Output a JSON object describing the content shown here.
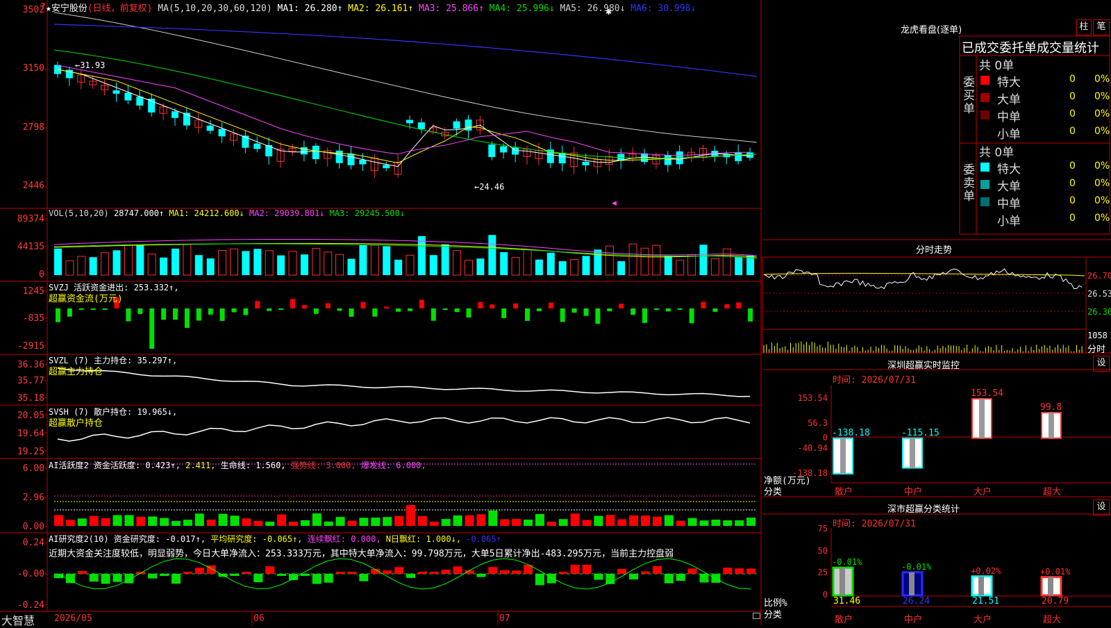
{
  "header": {
    "stock": "★安宁股份",
    "period": "(日线，前复权)",
    "ma_title": "MA(5,10,20,30,60,120)",
    "ma_values": [
      {
        "label": "MA1: 26.280↑",
        "color": "#ffffff"
      },
      {
        "label": "MA2: 26.161↑",
        "color": "#ffff00"
      },
      {
        "label": "MA3: 25.866↑",
        "color": "#ff44ff"
      },
      {
        "label": "MA4: 25.996↓",
        "color": "#00e000"
      },
      {
        "label": "MA5: 26.980↓",
        "color": "#cfcfcf"
      },
      {
        "label": "MA6: 30.998↓",
        "color": "#3333ff"
      }
    ]
  },
  "price_axis": [
    "3502",
    "3150",
    "2798",
    "2446"
  ],
  "price_annotations": {
    "high": "←31.93",
    "low": "←24.46"
  },
  "vol": {
    "title": "VOL(5,10,20)",
    "items": [
      {
        "label": "28747.000↑",
        "color": "#ffffff"
      },
      {
        "label": "MA1: 24212.600↓",
        "color": "#ffff00"
      },
      {
        "label": "MA2: 29039.801↓",
        "color": "#ff44ff"
      },
      {
        "label": "MA3: 29245.500↓",
        "color": "#00e000"
      }
    ],
    "axis": [
      "89374",
      "44135",
      "0"
    ]
  },
  "svzj": {
    "line1": "SVZJ  活跃资金进出: 253.332↑,",
    "line2": "超赢资金流(万元)",
    "axis": [
      "1245",
      "-835",
      "-2915"
    ]
  },
  "svzl": {
    "line1": "SVZL (7) 主力持仓: 35.297↑,",
    "line2": "超赢主力持仓",
    "axis": [
      "36.36",
      "35.77",
      "35.18"
    ]
  },
  "svsh": {
    "line1": "SVSH (7) 散户持仓: 19.965↓,",
    "line2": "超赢散户持仓",
    "axis": [
      "20.05",
      "19.64",
      "19.25"
    ]
  },
  "ai1": {
    "items": [
      {
        "label": "AI活跃度2 资金活跃度: 0.423↑,",
        "color": "#ffffff"
      },
      {
        "label": "2.411,",
        "color": "#ffff00"
      },
      {
        "label": "生命线: 1.560,",
        "color": "#ffffff"
      },
      {
        "label": "强势线: 3.000,",
        "color": "#ff3030"
      },
      {
        "label": "爆发线: 6.000,",
        "color": "#ff44ff"
      }
    ],
    "axis": [
      "6.00",
      "2.96",
      "0.00"
    ]
  },
  "ai2": {
    "items": [
      {
        "label": "AI研究度2(10) 资金研究度: -0.017↑,",
        "color": "#ffffff"
      },
      {
        "label": "平均研究度: -0.065↑,",
        "color": "#ffff00"
      },
      {
        "label": "连续飘红: 0.000,",
        "color": "#ff44ff"
      },
      {
        "label": "N日飘红: 1.000↓,",
        "color": "#ffff00"
      },
      {
        "label": "-0.065↑",
        "color": "#3333ff"
      }
    ],
    "comment": "近期大资金关注度较低，明显弱势，今日大单净流入：253.333万元，其中特大单净流入：99.798万元，大单5日累计净出-483.295万元，当前主力控盘弱",
    "axis": [
      "0.24",
      "-0.00",
      "-0.24"
    ]
  },
  "bottom": {
    "brand": "大智慧",
    "dates": [
      "2026/05",
      "06",
      "07"
    ]
  },
  "dragon": {
    "title": "龙虎看盘(逐单)",
    "tabs": [
      "柱",
      "笔"
    ],
    "subtitle": "已成交委托单成交量统计",
    "buy_label": "委买单",
    "sell_label": "委卖单",
    "buy_total": "共 0单",
    "sell_total": "共 0单",
    "buy_rows": [
      {
        "name": "特大",
        "n": "0",
        "p": "0%",
        "color": "#ff0000"
      },
      {
        "name": "大单",
        "n": "0",
        "p": "0%",
        "color": "#a00000"
      },
      {
        "name": "中单",
        "n": "0",
        "p": "0%",
        "color": "#700000"
      },
      {
        "name": "小单",
        "n": "0",
        "p": "0%",
        "color": ""
      }
    ],
    "sell_rows": [
      {
        "name": "特大",
        "n": "0",
        "p": "0%",
        "color": "#00ffff"
      },
      {
        "name": "大单",
        "n": "0",
        "p": "0%",
        "color": "#00a0a0"
      },
      {
        "name": "中单",
        "n": "0",
        "p": "0%",
        "color": "#007070"
      },
      {
        "name": "小单",
        "n": "0",
        "p": "0%",
        "color": ""
      }
    ]
  },
  "intraday": {
    "title": "分时走势",
    "axis": [
      "26.70",
      "26.53",
      "26.36"
    ],
    "vol_top": "1058",
    "vol_label": "分时"
  },
  "monitor": {
    "title": "深圳超赢实时监控",
    "setting": "设",
    "time": "时间: 2026/07/31",
    "axis": [
      "153.54",
      "56.3",
      "0",
      "-40.94",
      "-138.18"
    ],
    "ylabel": "净额(万元)",
    "xlabel": "分类",
    "bars": [
      {
        "cat": "散户",
        "value": -138.18,
        "label": "-138.18"
      },
      {
        "cat": "中户",
        "value": -115.15,
        "label": "-115.15"
      },
      {
        "cat": "大户",
        "value": 153.54,
        "label": "153.54"
      },
      {
        "cat": "超大",
        "value": 99.8,
        "label": "99.8"
      }
    ]
  },
  "classify": {
    "title": "深市超赢分类统计",
    "setting": "设",
    "time": "时间: 2026/07/31",
    "axis": [
      "75",
      "50",
      "25",
      "0"
    ],
    "ylabel": "比例%",
    "xlabel": "分类",
    "bars": [
      {
        "cat": "散户",
        "value": 31.46,
        "delta": "-0.01%",
        "label": "31.46"
      },
      {
        "cat": "中户",
        "value": 26.24,
        "delta": "-0.01%",
        "label": "26.24"
      },
      {
        "cat": "大户",
        "value": 21.51,
        "delta": "+0.02%",
        "label": "21.51"
      },
      {
        "cat": "超大",
        "value": 20.79,
        "delta": "+0.01%",
        "label": "20.79"
      }
    ]
  },
  "chart_data": [
    {
      "type": "bar",
      "title": "深圳超赢实时监控",
      "categories": [
        "散户",
        "中户",
        "大户",
        "超大"
      ],
      "values": [
        -138.18,
        -115.15,
        153.54,
        99.8
      ],
      "ylabel": "净额(万元)",
      "xlabel": "分类",
      "ylim": [
        -138.18,
        153.54
      ]
    },
    {
      "type": "bar",
      "title": "深市超赢分类统计",
      "categories": [
        "散户",
        "中户",
        "大户",
        "超大"
      ],
      "values": [
        31.46,
        26.24,
        21.51,
        20.79
      ],
      "ylabel": "比例%",
      "xlabel": "分类",
      "ylim": [
        0,
        75
      ]
    }
  ]
}
